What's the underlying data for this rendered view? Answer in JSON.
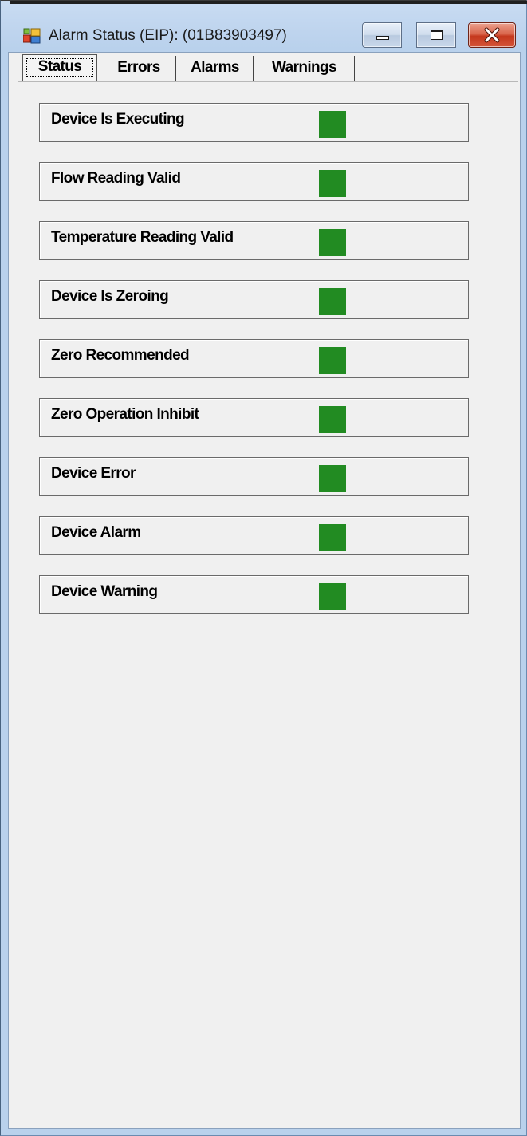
{
  "window": {
    "title": "Alarm Status (EIP): (01B83903497)",
    "icon": "application-window-icon"
  },
  "tabs": [
    {
      "label": "Status",
      "active": true
    },
    {
      "label": "Errors",
      "active": false
    },
    {
      "label": "Alarms",
      "active": false
    },
    {
      "label": "Warnings",
      "active": false
    }
  ],
  "status_items": [
    {
      "label": "Device Is Executing",
      "indicator_color": "#228b22"
    },
    {
      "label": "Flow Reading Valid",
      "indicator_color": "#228b22"
    },
    {
      "label": "Temperature Reading Valid",
      "indicator_color": "#228b22"
    },
    {
      "label": "Device Is Zeroing",
      "indicator_color": "#228b22"
    },
    {
      "label": "Zero Recommended",
      "indicator_color": "#228b22"
    },
    {
      "label": "Zero Operation Inhibit",
      "indicator_color": "#228b22"
    },
    {
      "label": "Device Error",
      "indicator_color": "#228b22"
    },
    {
      "label": "Device Alarm",
      "indicator_color": "#228b22"
    },
    {
      "label": "Device Warning",
      "indicator_color": "#228b22"
    }
  ],
  "colors": {
    "indicator_green": "#228b22",
    "titlebar": "#bed4ee",
    "client_bg": "#f0f0f0"
  }
}
